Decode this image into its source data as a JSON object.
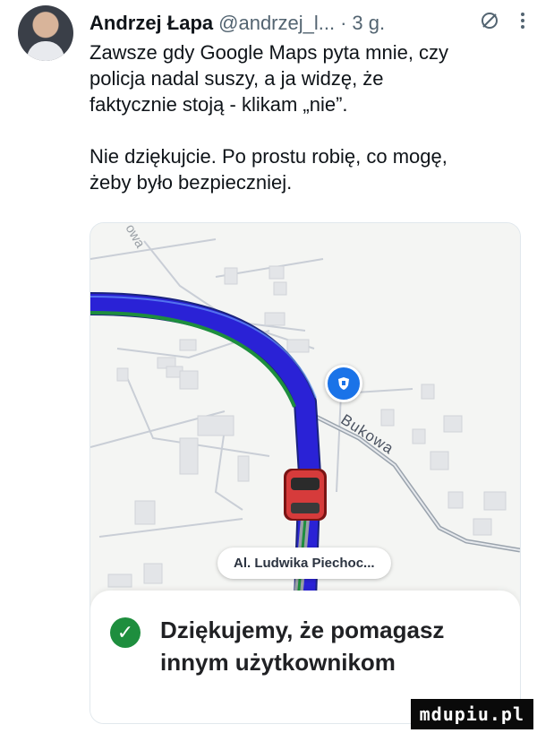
{
  "tweet": {
    "author_name": "Andrzej Łapa",
    "handle": "@andrzej_l...",
    "separator": "·",
    "time": "3 g.",
    "grok_icon": "grok-icon",
    "more_icon": "more-vertical-icon",
    "text_1": "Zawsze gdy Google Maps pyta mnie, czy\npolicja nadal suszy, a ja widzę, że\nfaktycznie stoją - klikam „nie”.",
    "text_2": "Nie dziękujcie. Po prostu robię, co mogę,\nżeby było bezpieczniej."
  },
  "map_card": {
    "street_label": "Al. Ludwika Piechoc...",
    "road_label_bukowa": "Bukowa",
    "road_label_top": "owa",
    "police_pin_icon": "police-icon",
    "car_icon": "car-icon",
    "route_color": "#2a22d6",
    "route_passed_color": "#1e8e3e",
    "feedback_text": "Dziękujemy, że pomagasz\ninnym użytkownikom",
    "check_icon": "check-circle-icon",
    "check_color": "#1e8e3e"
  },
  "watermark": "mdupiu.pl"
}
